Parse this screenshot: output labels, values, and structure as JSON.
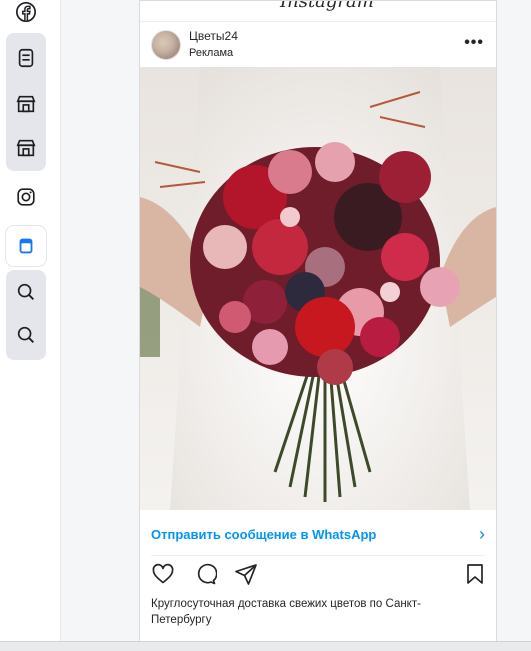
{
  "sidebar": {
    "items": [
      {
        "icon": "facebook-icon"
      },
      {
        "icon": "feed-icon"
      },
      {
        "icon": "marketplace-icon"
      },
      {
        "icon": "marketplace-icon"
      },
      {
        "icon": "instagram-icon"
      },
      {
        "icon": "feed-icon"
      },
      {
        "icon": "search-icon"
      },
      {
        "icon": "search-icon"
      }
    ],
    "accent": "#1877f2"
  },
  "header": {
    "logo_text": "Instagram"
  },
  "post": {
    "account_name": "Цветы24",
    "sponsored_label": "Реклама",
    "more_label": "•••",
    "cta_label": "Отправить сообщение в WhatsApp",
    "cta_chevron": "›",
    "caption": "Круглосуточная доставка свежих цветов по Санкт-Петербургу",
    "cta_color": "#0095f6"
  }
}
